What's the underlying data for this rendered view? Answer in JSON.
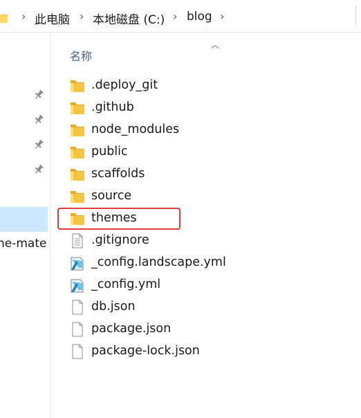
{
  "address": {
    "crumbs": [
      "此电脑",
      "本地磁盘 (C:)",
      "blog"
    ]
  },
  "nav": {
    "partial_item": "ne-mate"
  },
  "list": {
    "column_name": "名称",
    "files": [
      {
        "name": ".deploy_git",
        "icon": "folder-icon"
      },
      {
        "name": ".github",
        "icon": "folder-icon"
      },
      {
        "name": "node_modules",
        "icon": "folder-icon"
      },
      {
        "name": "public",
        "icon": "folder-icon"
      },
      {
        "name": "scaffolds",
        "icon": "folder-icon"
      },
      {
        "name": "source",
        "icon": "folder-icon"
      },
      {
        "name": "themes",
        "icon": "folder-icon"
      },
      {
        "name": ".gitignore",
        "icon": "text-file-icon"
      },
      {
        "name": "_config.landscape.yml",
        "icon": "yml-file-icon"
      },
      {
        "name": "_config.yml",
        "icon": "yml-file-icon"
      },
      {
        "name": "db.json",
        "icon": "file-icon"
      },
      {
        "name": "package.json",
        "icon": "file-icon"
      },
      {
        "name": "package-lock.json",
        "icon": "file-icon"
      }
    ]
  },
  "colors": {
    "folder": "#f6c445",
    "selection": "#cce8ff",
    "highlight": "#e53935"
  }
}
